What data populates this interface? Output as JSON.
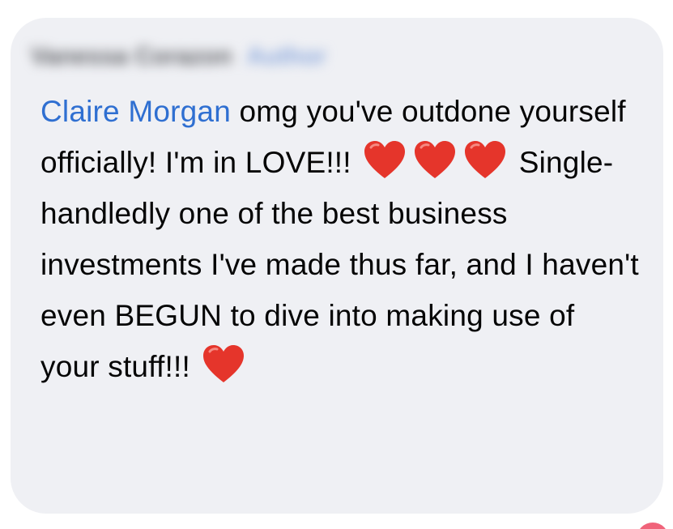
{
  "comment": {
    "author": {
      "name": "Vanessa Corazon",
      "badge": "Author"
    },
    "mention": "Claire Morgan",
    "text_part1": " omg you've outdone yourself officially! I'm in LOVE!!! ",
    "text_part2": " Single-handledly one of the best business investments I've made thus far, and I haven't even BEGUN to dive into making use of your stuff!!! ",
    "emoji": "heart-icon",
    "colors": {
      "bubble": "#eff0f4",
      "mention": "#2f6fd1",
      "text": "#050505",
      "heart": "#e5352b",
      "reaction": "#f0637a"
    }
  }
}
